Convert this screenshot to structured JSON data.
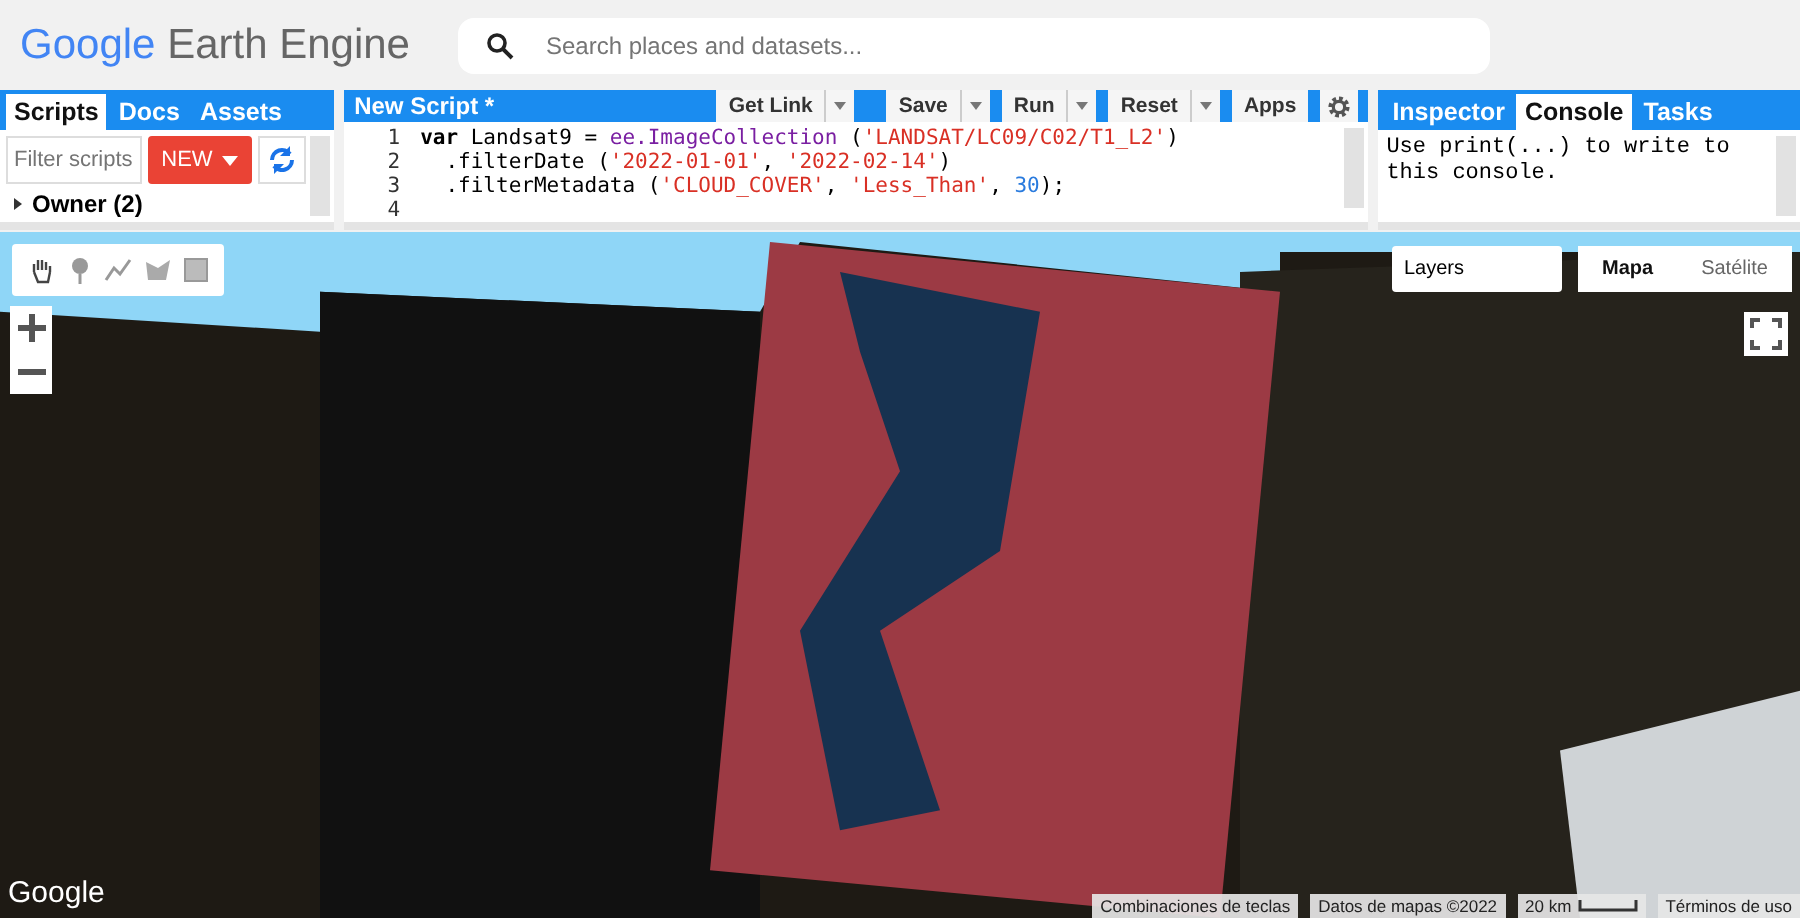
{
  "header": {
    "logo": {
      "brand": "Google",
      "product": "Earth Engine"
    },
    "search": {
      "placeholder": "Search places and datasets..."
    }
  },
  "scripts_panel": {
    "tabs": [
      {
        "label": "Scripts",
        "selected": true
      },
      {
        "label": "Docs",
        "selected": false
      },
      {
        "label": "Assets",
        "selected": false
      }
    ],
    "filter": {
      "placeholder": "Filter scripts"
    },
    "new_button": "NEW",
    "tree": [
      {
        "label": "Owner (2)",
        "expanded": false
      }
    ]
  },
  "editor": {
    "title": "New Script *",
    "buttons": [
      {
        "label": "Get Link",
        "dropdown": true
      },
      {
        "label": "Save",
        "dropdown": true
      },
      {
        "label": "Run",
        "dropdown": true
      },
      {
        "label": "Reset",
        "dropdown": true
      },
      {
        "label": "Apps",
        "dropdown": false
      }
    ],
    "lines": [
      {
        "number": "1",
        "tokens": [
          {
            "kind": "keyword",
            "text": "var"
          },
          {
            "kind": "plain",
            "text": " Landsat9 = "
          },
          {
            "kind": "call",
            "text": "ee.ImageCollection"
          },
          {
            "kind": "plain",
            "text": " ("
          },
          {
            "kind": "string",
            "text": "'LANDSAT/LC09/C02/T1_L2'"
          },
          {
            "kind": "plain",
            "text": ")"
          }
        ]
      },
      {
        "number": "2",
        "tokens": [
          {
            "kind": "plain",
            "text": "  .filterDate ("
          },
          {
            "kind": "string",
            "text": "'2022-01-01'"
          },
          {
            "kind": "plain",
            "text": ", "
          },
          {
            "kind": "string",
            "text": "'2022-02-14'"
          },
          {
            "kind": "plain",
            "text": ")"
          }
        ]
      },
      {
        "number": "3",
        "tokens": [
          {
            "kind": "plain",
            "text": "  .filterMetadata ("
          },
          {
            "kind": "string",
            "text": "'CLOUD_COVER'"
          },
          {
            "kind": "plain",
            "text": ", "
          },
          {
            "kind": "string",
            "text": "'Less_Than'"
          },
          {
            "kind": "plain",
            "text": ", "
          },
          {
            "kind": "number",
            "text": "30"
          },
          {
            "kind": "plain",
            "text": ");"
          }
        ]
      },
      {
        "number": "4"
      }
    ]
  },
  "right_panel": {
    "tabs": [
      {
        "label": "Inspector",
        "selected": false
      },
      {
        "label": "Console",
        "selected": true
      },
      {
        "label": "Tasks",
        "selected": false
      }
    ],
    "console_text": "Use print(...) to write to this console."
  },
  "map": {
    "layers_button": "Layers",
    "map_types": [
      {
        "label": "Mapa",
        "selected": true
      },
      {
        "label": "Satélite",
        "selected": false
      }
    ],
    "footer_logo": "Google",
    "attribution": [
      "Combinaciones de teclas",
      "Datos de mapas ©2022"
    ],
    "scale": "20 km",
    "terms": "Términos de uso"
  }
}
